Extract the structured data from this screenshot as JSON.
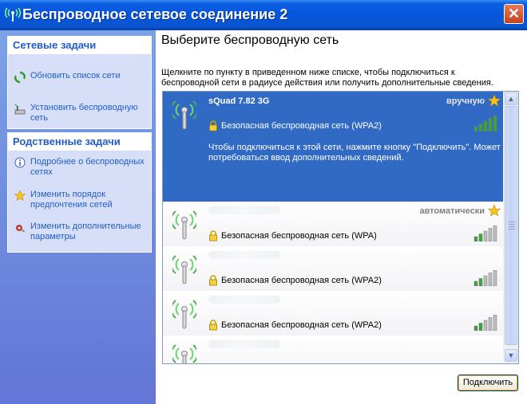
{
  "window": {
    "title": "Беспроводное сетевое соединение 2",
    "close_label": "✕"
  },
  "left_pane": {
    "network_tasks": {
      "title": "Сетевые задачи",
      "items": [
        {
          "label": "Обновить список сети",
          "icon": "refresh-icon"
        },
        {
          "label": "Установить беспроводную сеть",
          "icon": "setup-network-icon"
        }
      ]
    },
    "related_tasks": {
      "title": "Родственные задачи",
      "items": [
        {
          "label": "Подробнее о беспроводных сетях",
          "icon": "info-icon"
        },
        {
          "label": "Изменить порядок предпочтения сетей",
          "icon": "star-icon"
        },
        {
          "label": "Изменить дополнительные параметры",
          "icon": "settings-icon"
        }
      ]
    }
  },
  "main": {
    "heading": "Выберите беспроводную сеть",
    "description": "Щелкните по пункту в приведенном ниже списке, чтобы подключиться к беспроводной сети в радиусе действия или получить дополнительные сведения.",
    "networks": [
      {
        "ssid": "sQuad 7.82 3G",
        "mode": "вручную",
        "security": "Безопасная беспроводная сеть (WPA2)",
        "info": "Чтобы подключиться к этой сети, нажмите кнопку \"Подключить\". Может потребоваться ввод дополнительных сведений.",
        "signal_bars": 5,
        "selected": true,
        "preferred": true
      },
      {
        "ssid": "",
        "mode": "автоматически",
        "security": "Безопасная беспроводная сеть (WPA)",
        "signal_bars": 2,
        "preferred": true
      },
      {
        "ssid": "",
        "mode": "",
        "security": "Безопасная беспроводная сеть (WPA2)",
        "signal_bars": 2
      },
      {
        "ssid": "",
        "mode": "",
        "security": "Безопасная беспроводная сеть (WPA2)",
        "signal_bars": 2
      },
      {
        "ssid": "",
        "mode": "",
        "security": "",
        "signal_bars": 0
      }
    ],
    "connect_label": "Подключить"
  },
  "colors": {
    "title_bar": "#0655dc",
    "left_pane_top": "#7ba2e7",
    "left_pane_bottom": "#6375d6",
    "task_link": "#215dc6",
    "selection": "#316ac5",
    "signal_active": "#3aa33a",
    "signal_inactive": "#bdbdbd"
  }
}
